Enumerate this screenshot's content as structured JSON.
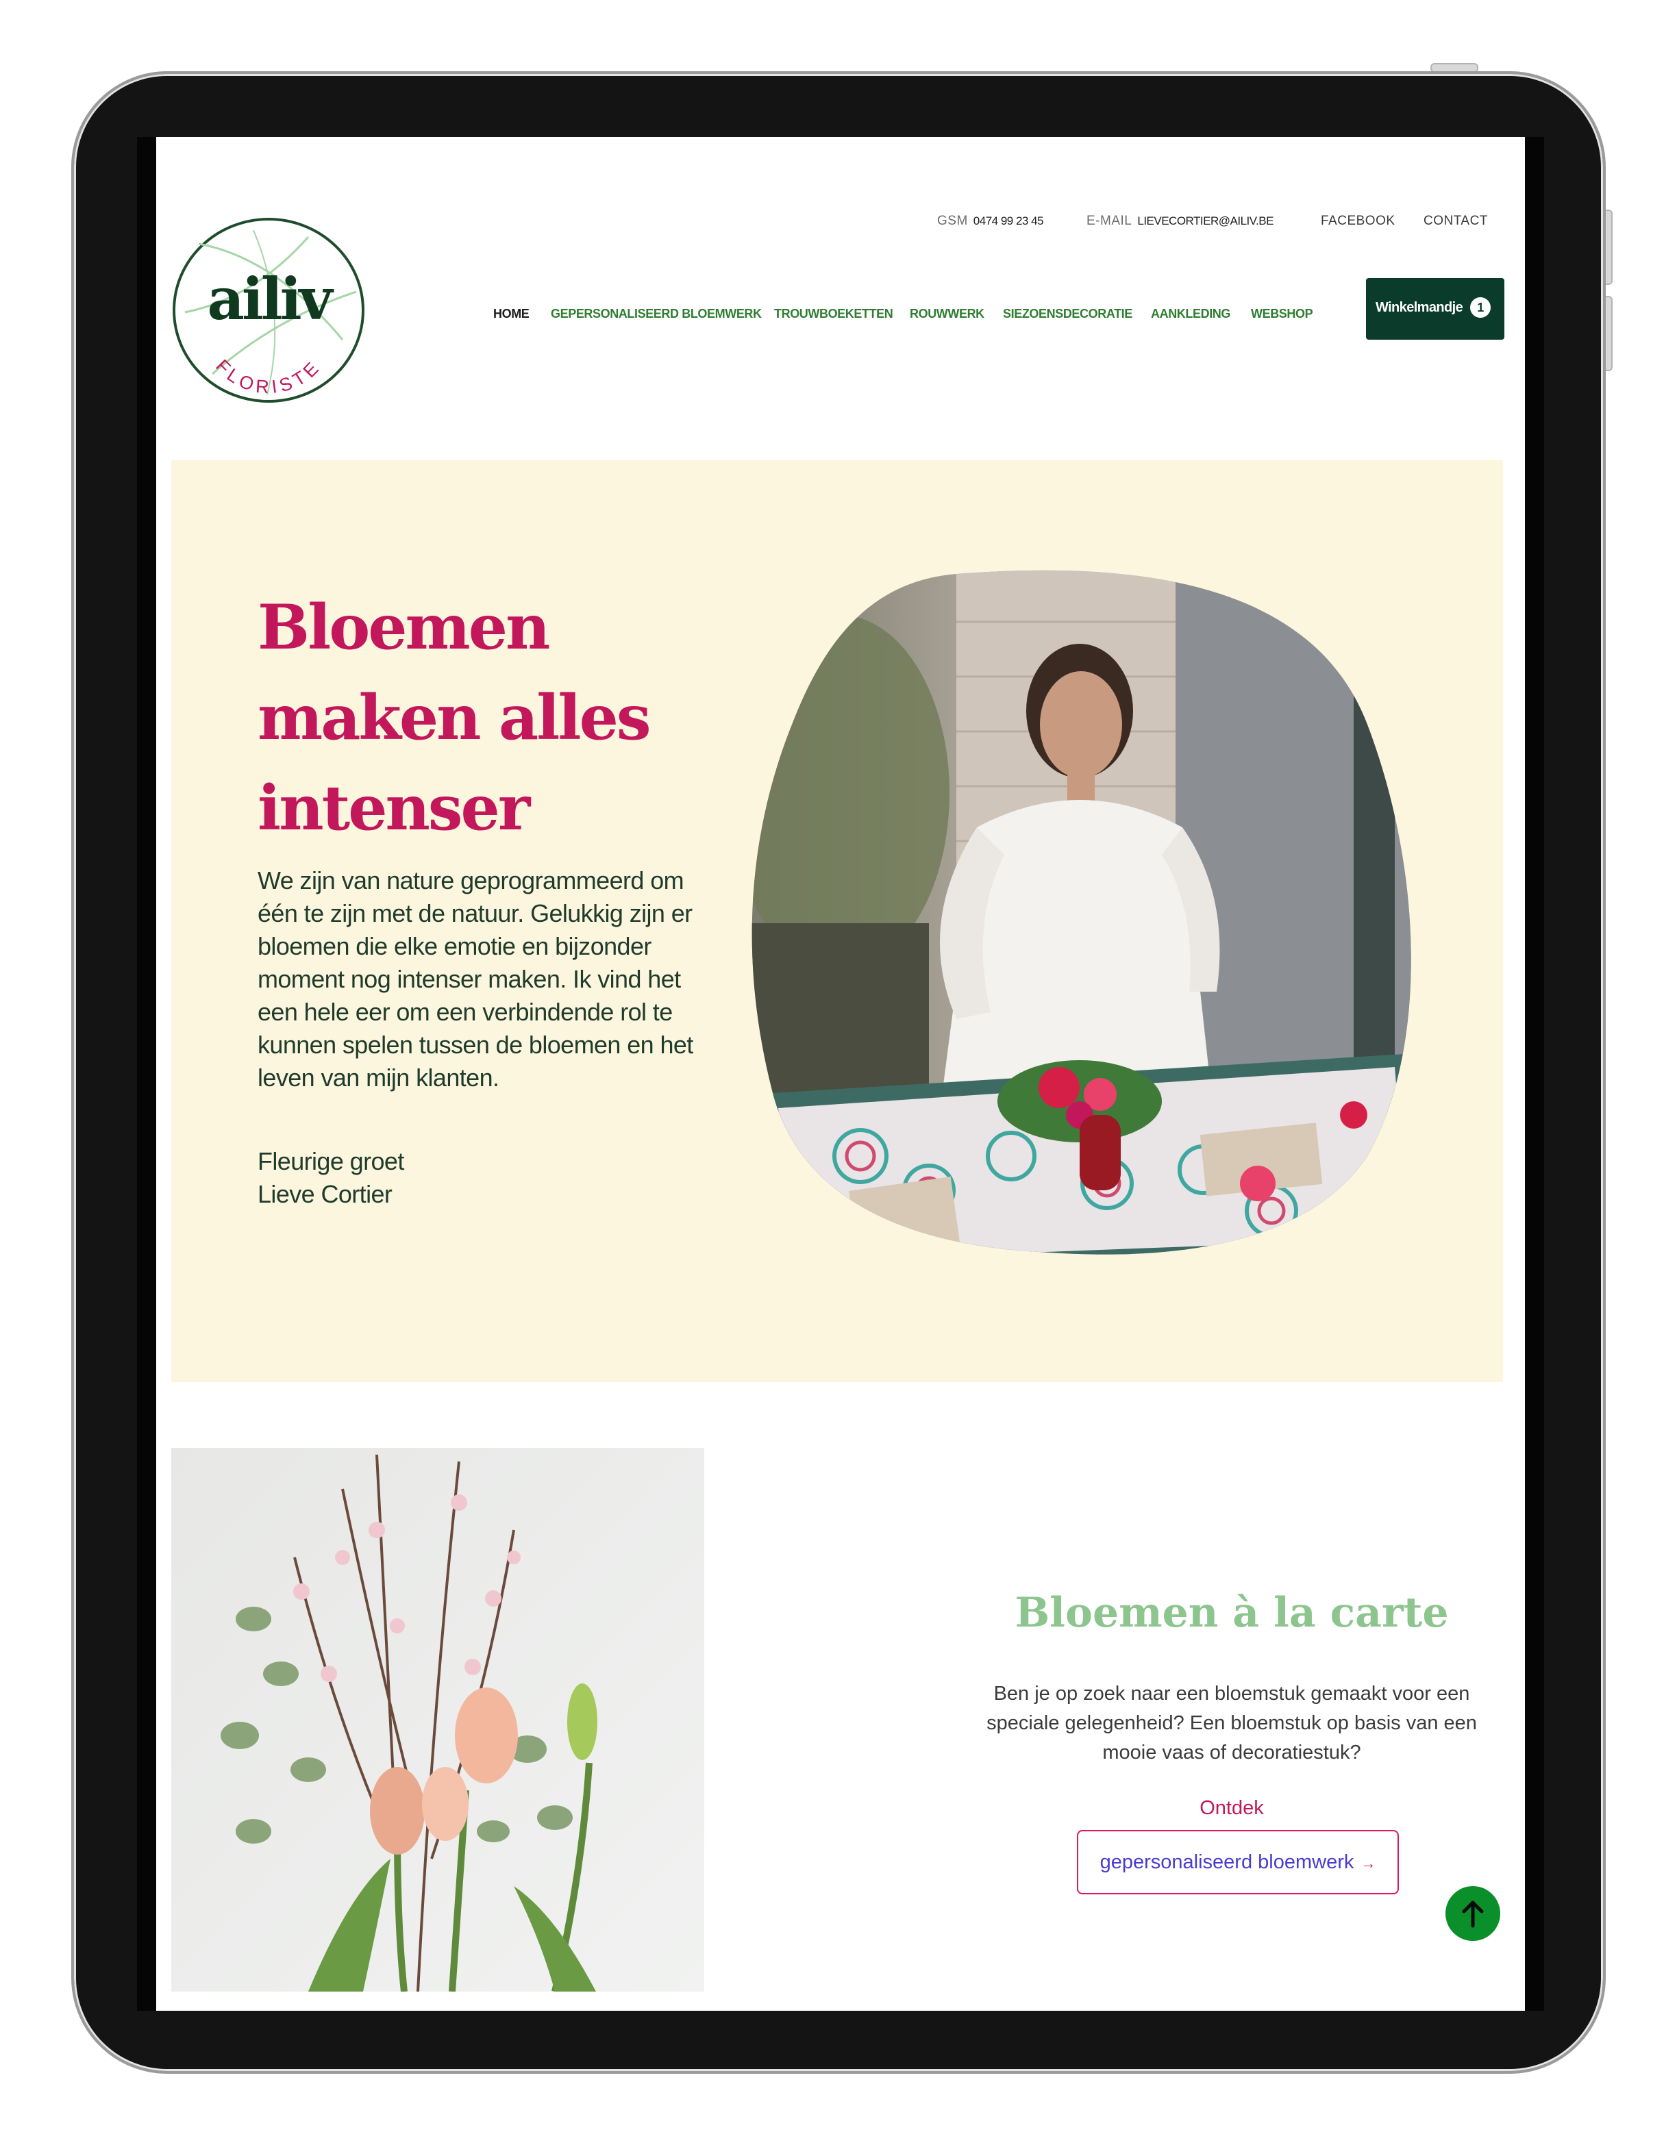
{
  "header": {
    "logo": {
      "wordmark": "ailiv",
      "tagline": "FLORISTE"
    },
    "topbar": {
      "gsm_label": "GSM",
      "gsm_value": "0474 99 23 45",
      "email_label": "E-MAIL",
      "email_value": "LIEVECORTIER@AILIV.BE",
      "facebook": "FACEBOOK",
      "contact": "CONTACT"
    },
    "nav": [
      {
        "label": "HOME",
        "active": true
      },
      {
        "label": "GEPERSONALISEERD BLOEMWERK"
      },
      {
        "label": "TROUWBOEKETTEN"
      },
      {
        "label": "ROUWWERK"
      },
      {
        "label": "SIEZOENSDECORATIE"
      },
      {
        "label": "AANKLEDING"
      },
      {
        "label": "WEBSHOP"
      }
    ],
    "cart": {
      "label": "Winkelmandje",
      "count": "1"
    }
  },
  "hero": {
    "title_lines": [
      "Bloemen",
      "maken alles",
      "intenser"
    ],
    "paragraph": "We zijn van nature geprogrammeerd om één te zijn met de natuur. Gelukkig zijn er bloemen die elke emotie en bijzonder moment nog intenser maken. Ik vind het een hele eer om een verbindende rol te kunnen spelen tussen de bloemen en het leven van mijn klanten.",
    "sign_greeting": "Fleurige groet",
    "sign_name": "Lieve Cortier"
  },
  "carte": {
    "title": "Bloemen à la carte",
    "text": "Ben je op zoek naar een bloemstuk gemaakt voor een speciale gelegenheid? Een bloemstuk op basis van een mooie vaas of decoratiestuk?",
    "discover_label": "Ontdek",
    "button_label": "gepersonaliseerd bloemwerk",
    "button_arrow": "→"
  },
  "colors": {
    "brand_pink": "#c2185b",
    "brand_green": "#2e7d32",
    "cart_bg": "#0b3b2a",
    "hero_bg": "#fdf6df",
    "carte_title": "#8dc58e",
    "scroll_top_bg": "#0a8f2a"
  },
  "icons": {
    "scroll_top": "arrow-up-icon",
    "logo_leaf": "leaf-outline-icon"
  }
}
